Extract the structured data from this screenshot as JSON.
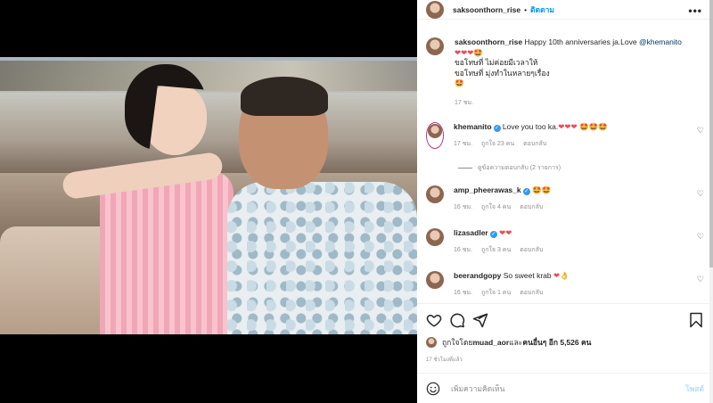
{
  "post": {
    "username": "saksoonthorn_rise",
    "dot": "•",
    "follow_label": "ติดตาม",
    "more_label": "•••"
  },
  "caption": {
    "username": "saksoonthorn_rise",
    "text_prefix": "Happy 10th anniversaries ja.Love ",
    "mention": "@khemanito",
    "emoji_line": "❤❤❤🤩",
    "line2": "ขอโทษที่ ไม่ค่อยมีเวลาให้",
    "line3": "ขอโทษที่ มุ่งทำในหลายๆเรื่อง",
    "line4": "🤩",
    "time": "17 ชม."
  },
  "comments": [
    {
      "username": "khemanito",
      "verified": true,
      "text": "Love you too ka.",
      "emoji": "❤❤❤ 🤩🤩🤩",
      "time": "17 ชม.",
      "likes": "ถูกใจ 23 คน",
      "reply": "ตอบกลับ",
      "replies_label": "ดูข้อความตอบกลับ (2 รายการ)"
    },
    {
      "username": "amp_pheerawas_k",
      "verified": true,
      "text": "",
      "emoji": "🤩🤩",
      "time": "16 ชม.",
      "likes": "ถูกใจ 4 คน",
      "reply": "ตอบกลับ"
    },
    {
      "username": "lizasadler",
      "verified": true,
      "text": "",
      "emoji": "❤❤",
      "time": "16 ชม.",
      "likes": "ถูกใจ 3 คน",
      "reply": "ตอบกลับ"
    },
    {
      "username": "beerandgopy",
      "verified": false,
      "text": "So sweet krab ",
      "emoji": "❤👌",
      "time": "16 ชม.",
      "likes": "ถูกใจ 1 คน",
      "reply": "ตอบกลับ"
    }
  ],
  "likes": {
    "prefix": "ถูกใจโดย ",
    "user": "muad_aor",
    "middle": " และ ",
    "others": "คนอื่นๆ อีก 5,526 คน"
  },
  "posted_time": "17 ชั่วโมงที่แล้ว",
  "comment_input": {
    "placeholder": "เพิ่มความคิดเห็น",
    "post_label": "โพสต์"
  },
  "icons": {
    "like": "heart-icon",
    "comment": "comment-icon",
    "share": "paper-plane-icon",
    "save": "bookmark-icon",
    "emoji": "smiley-icon"
  },
  "colors": {
    "link": "#00376b",
    "follow": "#0095f6",
    "verified": "#3897f0",
    "heart": "#ed4956"
  }
}
